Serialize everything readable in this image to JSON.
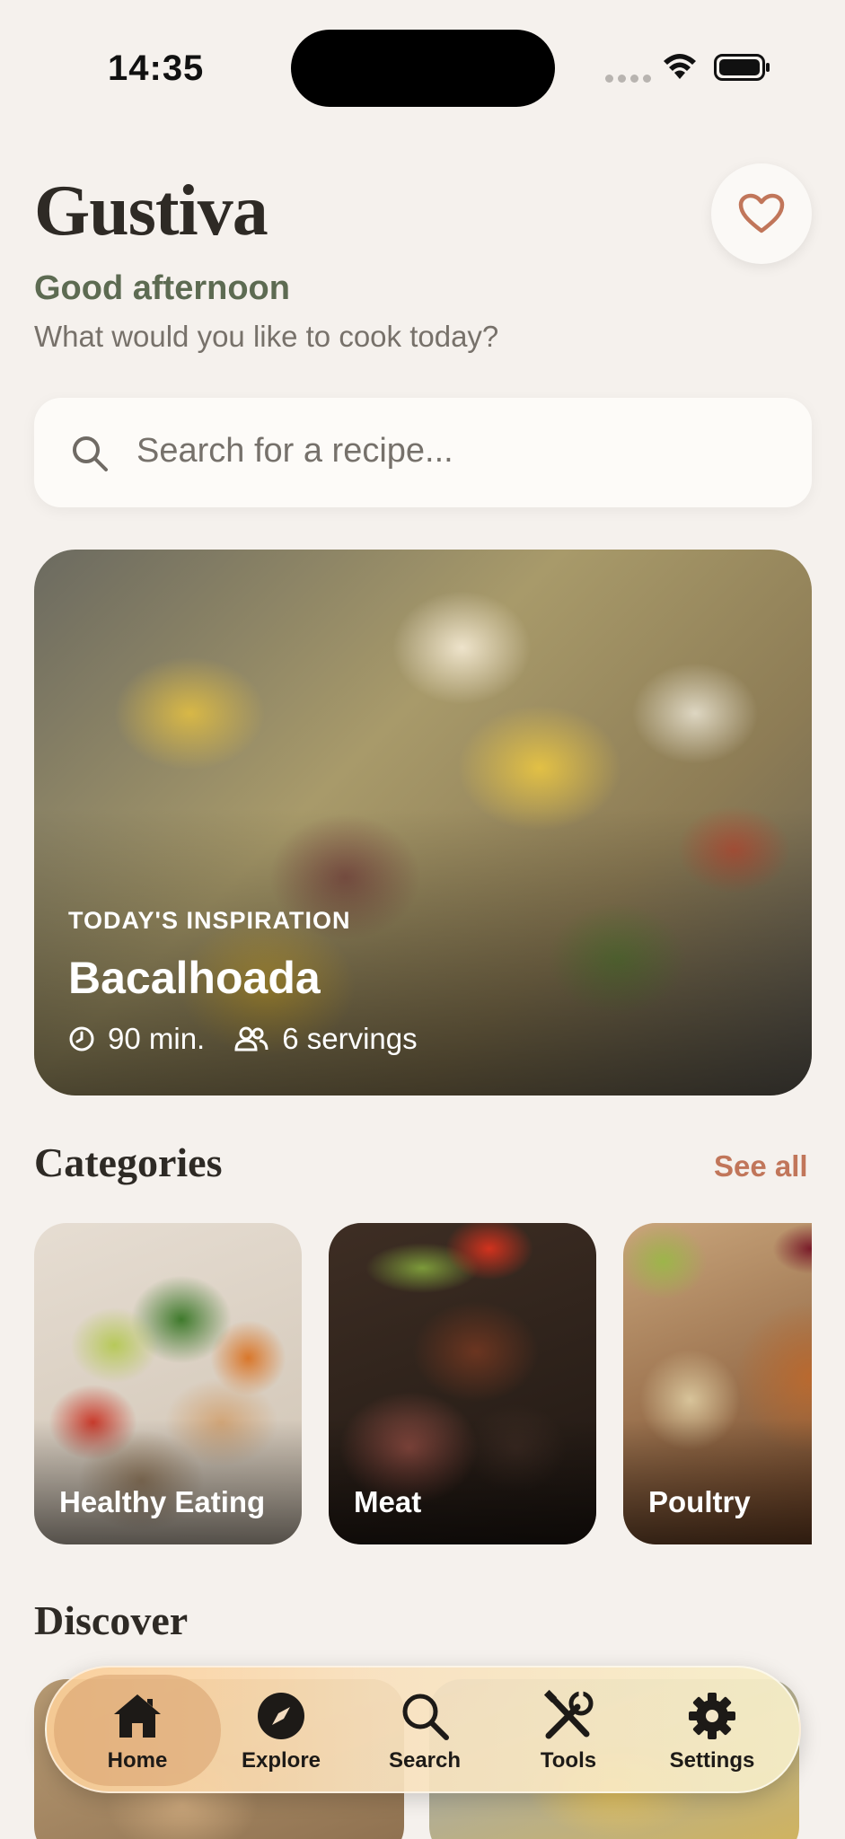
{
  "status_bar": {
    "time": "14:35"
  },
  "header": {
    "app_title": "Gustiva",
    "greeting": "Good afternoon",
    "subtitle": "What would you like to cook today?"
  },
  "search": {
    "placeholder": "Search for a recipe..."
  },
  "hero": {
    "label": "TODAY'S INSPIRATION",
    "title": "Bacalhoada",
    "time": "90 min.",
    "servings": "6 servings"
  },
  "categories": {
    "title": "Categories",
    "see_all": "See all",
    "items": [
      {
        "label": "Healthy Eating"
      },
      {
        "label": "Meat"
      },
      {
        "label": "Poultry"
      }
    ]
  },
  "discover": {
    "title": "Discover"
  },
  "tab_bar": {
    "tabs": [
      {
        "label": "Home",
        "icon": "home-icon",
        "active": true
      },
      {
        "label": "Explore",
        "icon": "compass-icon",
        "active": false
      },
      {
        "label": "Search",
        "icon": "search-icon",
        "active": false
      },
      {
        "label": "Tools",
        "icon": "tools-icon",
        "active": false
      },
      {
        "label": "Settings",
        "icon": "gear-icon",
        "active": false
      }
    ]
  },
  "colors": {
    "background": "#f5f1ed",
    "accent": "#c1765a",
    "greeting_green": "#5d6b52",
    "text_dark": "#2e2a25"
  }
}
